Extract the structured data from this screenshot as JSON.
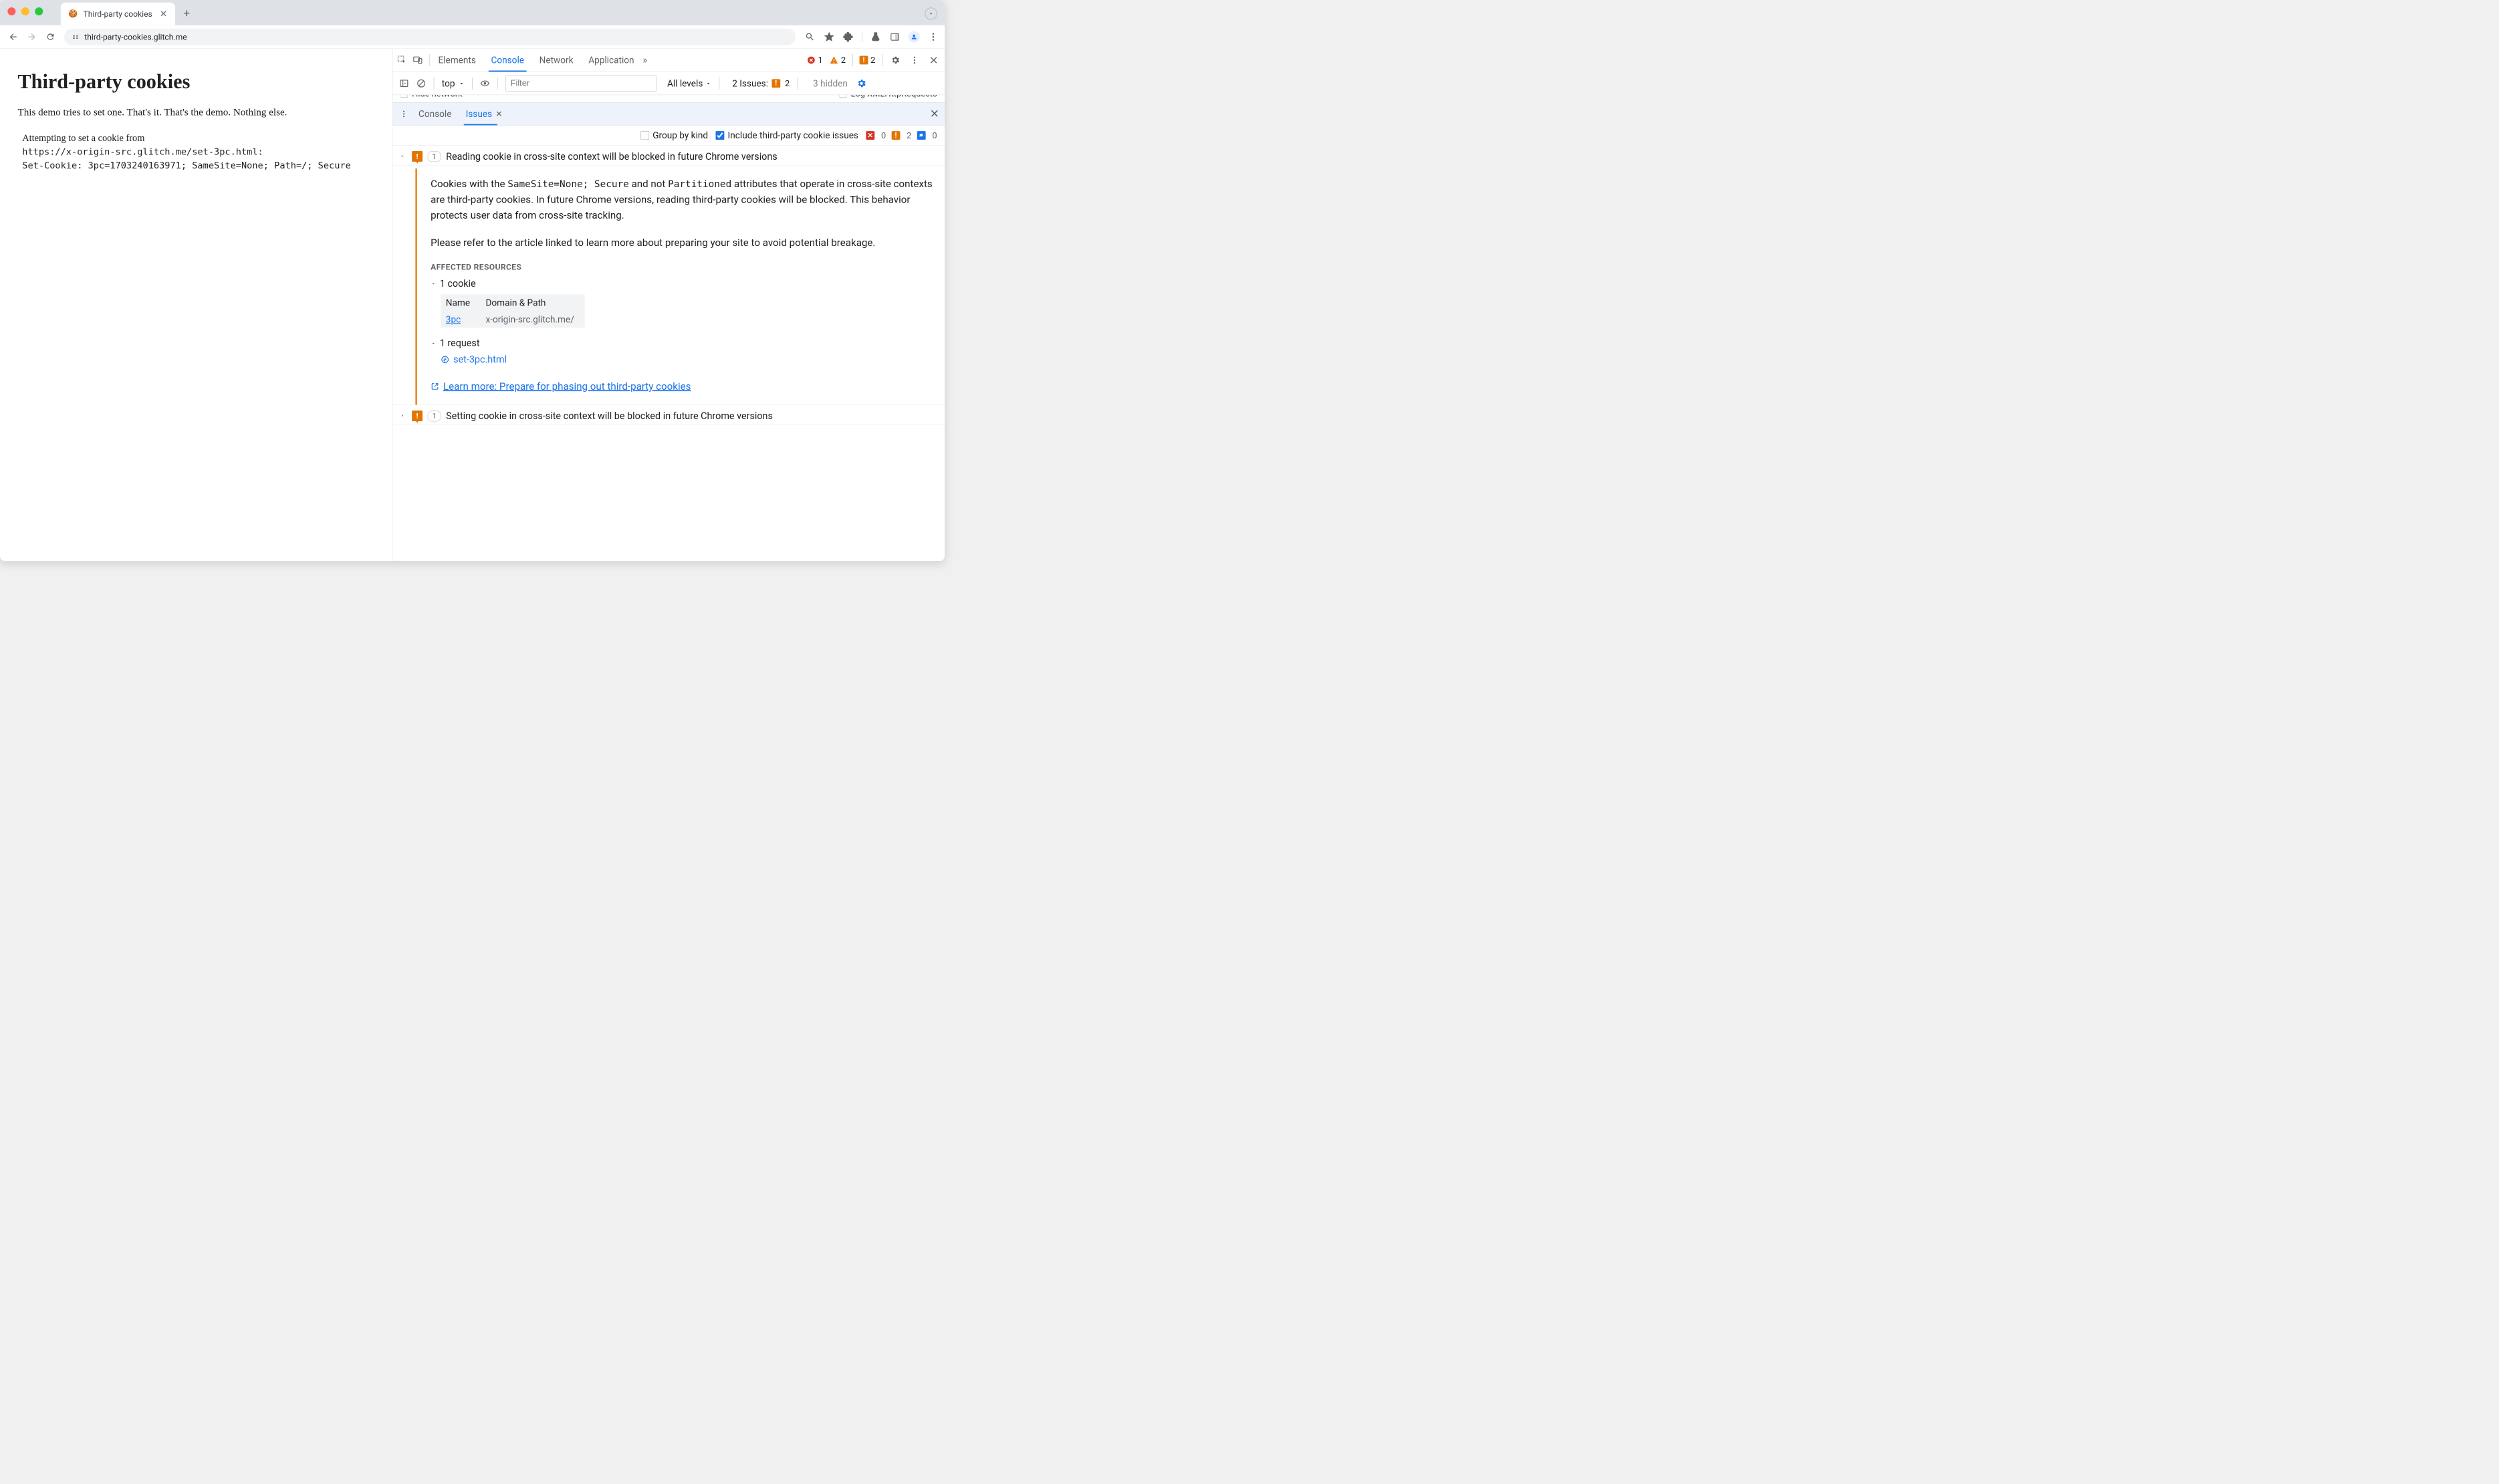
{
  "tab": {
    "title": "Third-party cookies",
    "favicon": "🍪"
  },
  "url": "third-party-cookies.glitch.me",
  "page": {
    "heading": "Third-party cookies",
    "paragraph": "This demo tries to set one. That's it. That's the demo. Nothing else.",
    "log_line1": "Attempting to set a cookie from",
    "log_line2": "https://x-origin-src.glitch.me/set-3pc.html:",
    "log_line3": "Set-Cookie: 3pc=1703240163971; SameSite=None; Path=/; Secure"
  },
  "devtools": {
    "tabs": [
      "Elements",
      "Console",
      "Network",
      "Application"
    ],
    "active_tab": "Console",
    "errors": 1,
    "warnings": 2,
    "issues": 2
  },
  "console_tb": {
    "context": "top",
    "filter_placeholder": "Filter",
    "levels": "All levels",
    "issues_label": "2 Issues:",
    "issues_count": 2,
    "hidden": "3 hidden"
  },
  "hidden_row": {
    "left": "Hide network",
    "right": "Log XMLHttpRequests"
  },
  "drawer": {
    "tabs": [
      "Console",
      "Issues"
    ],
    "active": "Issues"
  },
  "issues_tb": {
    "group_by_kind": "Group by kind",
    "include_3p": "Include third-party cookie issues",
    "include_3p_checked": true,
    "counts": {
      "err": 0,
      "warn": 2,
      "info": 0
    }
  },
  "issues": [
    {
      "expanded": true,
      "count": 1,
      "title": "Reading cookie in cross-site context will be blocked in future Chrome versions",
      "body_p1_pre": "Cookies with the ",
      "body_p1_code": "SameSite=None; Secure",
      "body_p1_mid": " and not ",
      "body_p1_code2": "Partitioned",
      "body_p1_post": " attributes that operate in cross-site contexts are third-party cookies. In future Chrome versions, reading third-party cookies will be blocked. This behavior protects user data from cross-site tracking.",
      "body_p2": "Please refer to the article linked to learn more about preparing your site to avoid potential breakage.",
      "affected_label": "Affected Resources",
      "cookie_label": "1 cookie",
      "cookie_table": {
        "headers": [
          "Name",
          "Domain & Path"
        ],
        "rows": [
          {
            "name": "3pc",
            "domain": "x-origin-src.glitch.me/"
          }
        ]
      },
      "request_label": "1 request",
      "request_name": "set-3pc.html",
      "learn_more": "Learn more: Prepare for phasing out third-party cookies"
    },
    {
      "expanded": false,
      "count": 1,
      "title": "Setting cookie in cross-site context will be blocked in future Chrome versions"
    }
  ]
}
